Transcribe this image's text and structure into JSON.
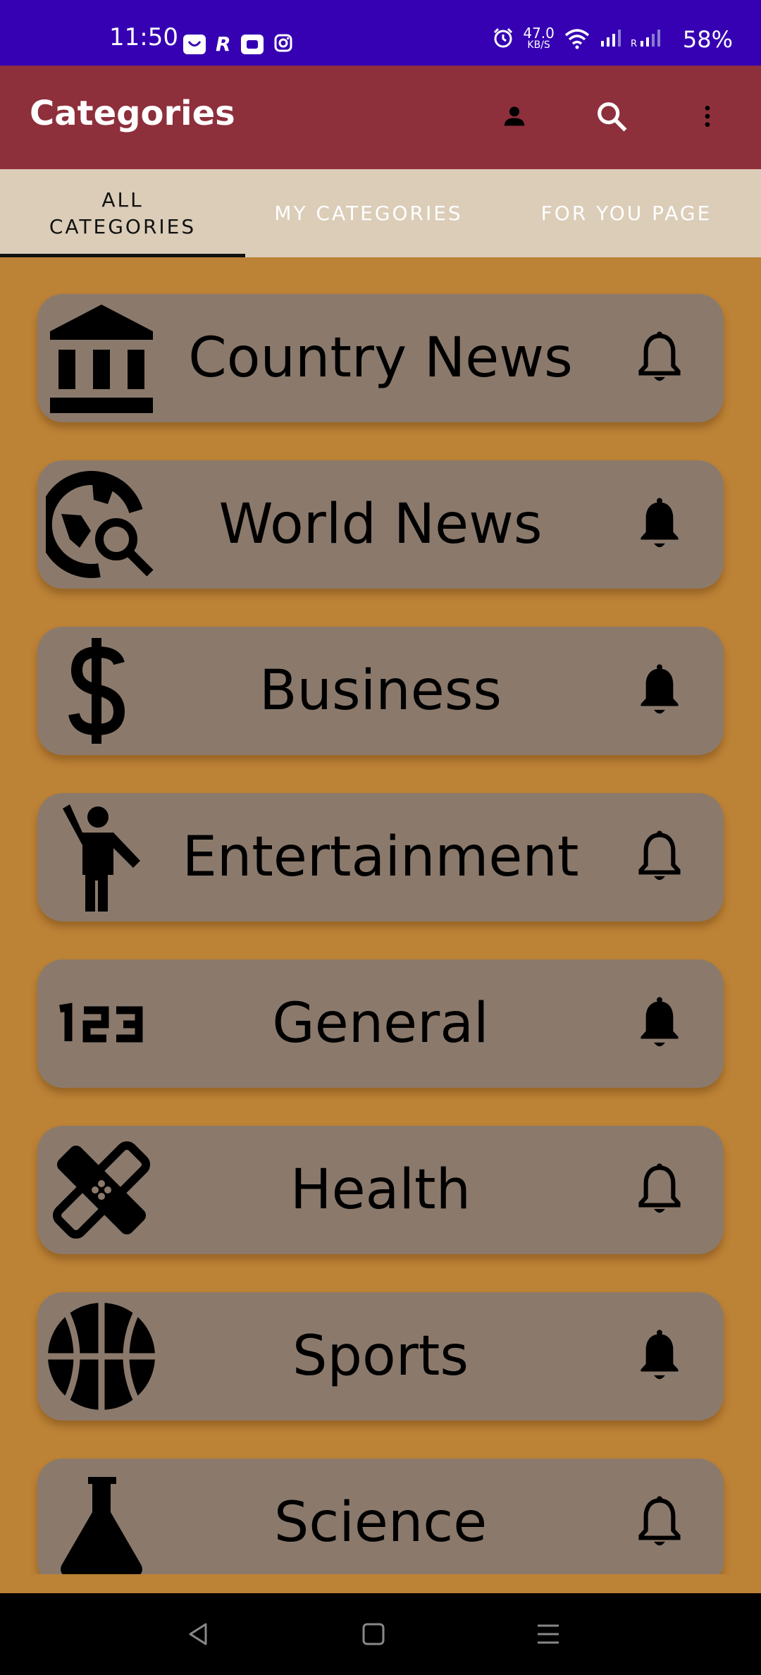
{
  "status_bar": {
    "time": "11:50",
    "speed_value": "47.0",
    "speed_unit": "KB/S",
    "battery": "58%",
    "icons": [
      "app-notification-icon",
      "r-icon",
      "plus-app-icon",
      "instagram-icon",
      "alarm-icon",
      "wifi-icon",
      "signal-icon",
      "signal-roaming-icon"
    ]
  },
  "app_bar": {
    "title": "Categories",
    "actions": [
      "account-icon",
      "search-icon",
      "more-vert-icon"
    ]
  },
  "tabs": [
    {
      "label_line1": "ALL",
      "label_line2": "CATEGORIES",
      "selected": true
    },
    {
      "label": "MY CATEGORIES",
      "selected": false
    },
    {
      "label": "FOR YOU PAGE",
      "selected": false
    }
  ],
  "categories": [
    {
      "name": "Country News",
      "icon": "bank-icon",
      "bell": "bell-outline-icon"
    },
    {
      "name": "World News",
      "icon": "travel-explore-icon",
      "bell": "bell-filled-icon"
    },
    {
      "name": "Business",
      "icon": "dollar-icon",
      "bell": "bell-filled-icon"
    },
    {
      "name": "Entertainment",
      "icon": "person-waving-icon",
      "bell": "bell-outline-icon"
    },
    {
      "name": "General",
      "icon": "numbers-123-icon",
      "bell": "bell-filled-icon"
    },
    {
      "name": "Health",
      "icon": "bandage-icon",
      "bell": "bell-outline-icon"
    },
    {
      "name": "Sports",
      "icon": "basketball-icon",
      "bell": "bell-filled-icon"
    },
    {
      "name": "Science",
      "icon": "flask-icon",
      "bell": "bell-outline-icon"
    }
  ],
  "colors": {
    "status_bar": "#3600B3",
    "app_bar": "#8E2F3C",
    "tabs_bg": "#DBCDB8",
    "page_bg": "#BC8236",
    "card_bg": "#8B7A6C"
  }
}
